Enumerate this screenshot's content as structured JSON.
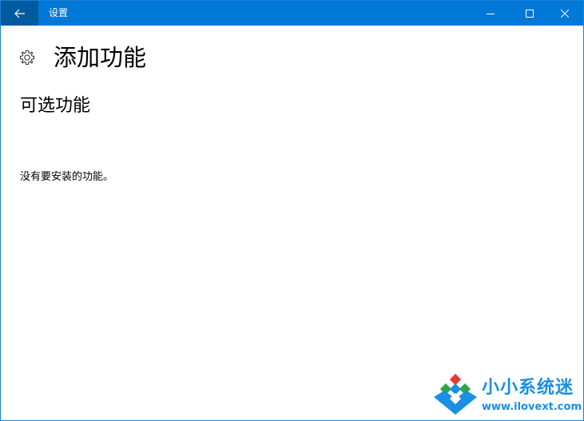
{
  "window": {
    "title": "设置",
    "accent_color": "#0078d7",
    "back_button_color": "#005a9e"
  },
  "icons": {
    "back": "arrow-left-icon",
    "minimize": "minimize-icon",
    "maximize": "maximize-icon",
    "close": "close-icon",
    "settings": "gear-icon"
  },
  "page": {
    "title": "添加功能",
    "section_title": "可选功能",
    "empty_message": "没有要安装的功能。"
  },
  "watermark": {
    "name": "小小系统迷",
    "url": "www.ilovext.com",
    "color": "#1b8fe0"
  }
}
